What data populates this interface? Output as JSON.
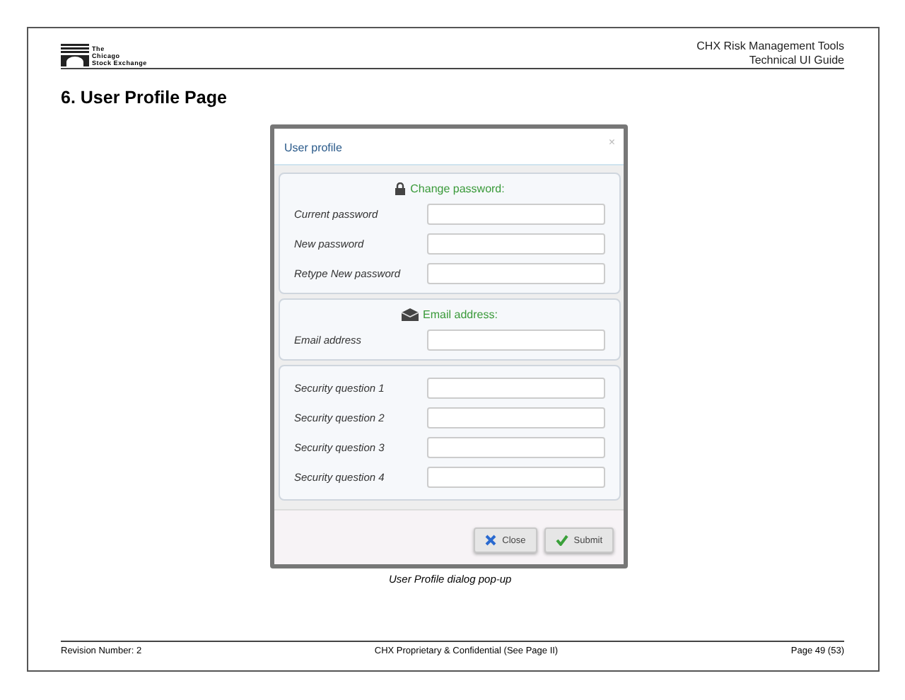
{
  "header": {
    "logo_lines": [
      "The",
      "Chicago",
      "Stock Exchange"
    ],
    "doc_title": "CHX Risk Management Tools",
    "doc_subtitle": "Technical UI Guide"
  },
  "heading": "6. User Profile Page",
  "dialog": {
    "title": "User profile",
    "close_glyph": "×",
    "sections": [
      {
        "kind": "password",
        "heading": "Change password:",
        "fields": [
          {
            "label": "Current password"
          },
          {
            "label": "New password"
          },
          {
            "label": "Retype New password"
          }
        ]
      },
      {
        "kind": "email",
        "heading": "Email address:",
        "fields": [
          {
            "label": "Email address"
          }
        ]
      },
      {
        "kind": "plain",
        "fields": [
          {
            "label": "Security question 1"
          },
          {
            "label": "Security question 2"
          },
          {
            "label": "Security question 3"
          },
          {
            "label": "Security question 4"
          }
        ]
      }
    ],
    "buttons": [
      {
        "kind": "close",
        "label": "Close"
      },
      {
        "kind": "submit",
        "label": "Submit"
      }
    ]
  },
  "caption": "User Profile dialog pop-up",
  "footer": {
    "revision": "Revision Number: 2",
    "notice": "CHX Proprietary & Confidential (See Page II)",
    "page": "Page 49 (53)"
  }
}
